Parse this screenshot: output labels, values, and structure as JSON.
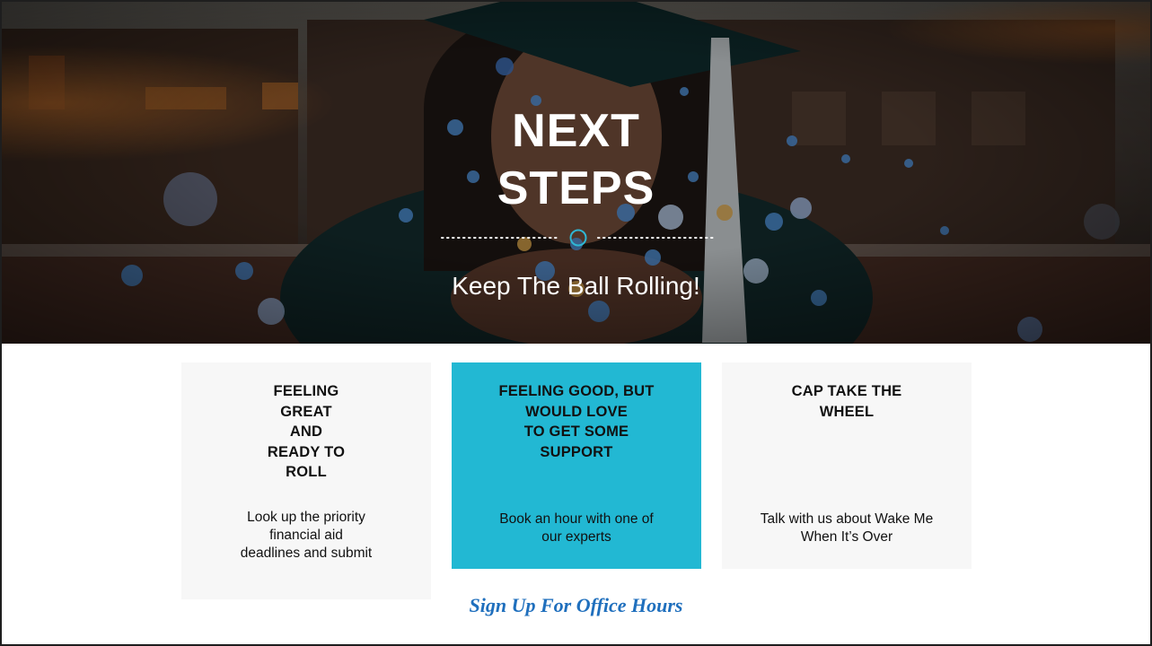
{
  "hero": {
    "title_lines": [
      "NEXT",
      "STEPS"
    ],
    "subtitle": "Keep The Ball Rolling!"
  },
  "cards": [
    {
      "title_lines": [
        "FEELING",
        "GREAT",
        "AND",
        "READY TO",
        "ROLL"
      ],
      "body_lines": [
        "Look up the priority",
        "financial aid",
        "deadlines and submit"
      ]
    },
    {
      "title_lines": [
        "FEELING GOOD, BUT",
        "WOULD LOVE",
        "TO GET SOME",
        "SUPPORT"
      ],
      "body_lines": [
        "Book an hour with one of",
        "our experts"
      ]
    },
    {
      "title_lines": [
        "CAP TAKE THE",
        "WHEEL"
      ],
      "body_lines": [
        "Talk with us about Wake Me",
        "When It’s Over"
      ]
    }
  ],
  "signup_link": "Sign Up For Office Hours",
  "colors": {
    "accent": "#22b8d3",
    "card_background": "#f7f7f7",
    "link": "#1f6fbd"
  }
}
